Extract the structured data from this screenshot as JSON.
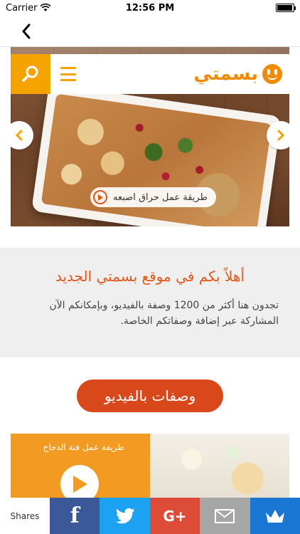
{
  "status": {
    "carrier": "Carrier",
    "time": "12:56 PM",
    "battery_level": 0.95
  },
  "nav": {
    "back_icon": "chevron-left-icon"
  },
  "header": {
    "logo_text": "بسمتي"
  },
  "hero": {
    "caption": "طريقة عمل حراق اصبعه"
  },
  "welcome": {
    "title": "أهلاً بكم في موقع بسمتي الجديد",
    "body": "تجدون هنا أكثر من 1200 وصفة بالفيديو، وبإمكانكم الآن المشاركة عبر إضافة وصفاتكم الخاصة."
  },
  "video_button": {
    "label": "وصفات بالفيديو"
  },
  "cards": [
    {
      "title": "طريقة عمل فتة الدجاج"
    }
  ],
  "share_bar": {
    "label": "Shares",
    "facebook_label": "f",
    "gplus_label": "G+",
    "icons": [
      "facebook-icon",
      "twitter-icon",
      "google-plus-icon",
      "email-icon",
      "crown-icon"
    ]
  },
  "colors": {
    "accent": "#f5a300",
    "brand_orange": "#f08a00",
    "button_red": "#d9481a"
  }
}
